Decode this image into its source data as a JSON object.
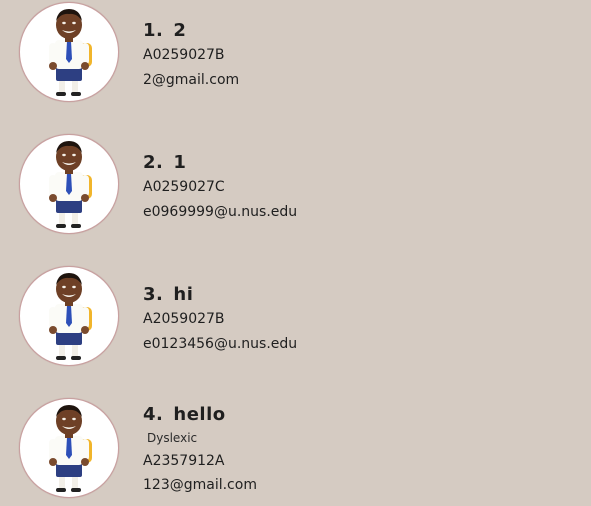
{
  "persons": [
    {
      "index": "1.",
      "name": "2",
      "tag": "",
      "matric": "A0259027B",
      "email": "2@gmail.com"
    },
    {
      "index": "2.",
      "name": "1",
      "tag": "",
      "matric": "A0259027C",
      "email": "e0969999@u.nus.edu"
    },
    {
      "index": "3.",
      "name": "hi",
      "tag": "",
      "matric": "A2059027B",
      "email": "e0123456@u.nus.edu"
    },
    {
      "index": "4.",
      "name": "hello",
      "tag": "Dyslexic",
      "matric": "A2357912A",
      "email": "123@gmail.com"
    }
  ],
  "colors": {
    "background": "#d5cbc2",
    "avatar_border": "#c9a0a0",
    "text": "#1f1f1f"
  },
  "icons": {
    "avatar": "student-avatar-icon"
  }
}
